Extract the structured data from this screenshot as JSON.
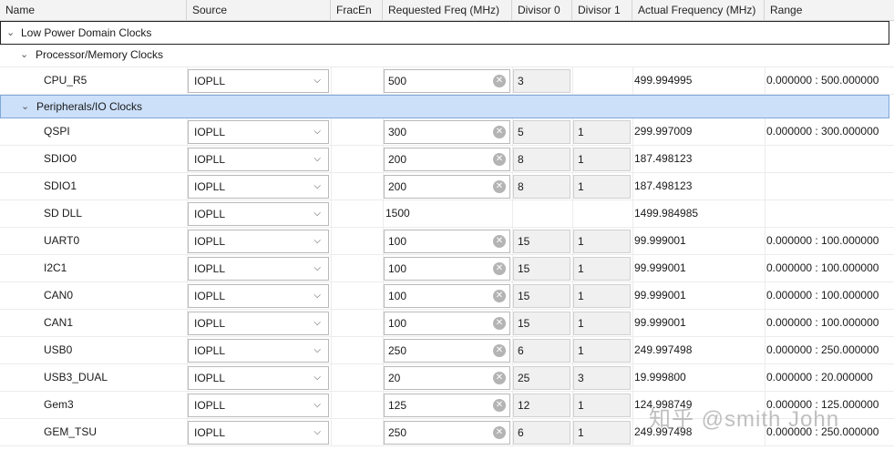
{
  "columns": [
    "Name",
    "Source",
    "FracEn",
    "Requested Freq (MHz)",
    "Divisor 0",
    "Divisor 1",
    "Actual Frequency (MHz)",
    "Range"
  ],
  "groups": {
    "low_power": "Low Power Domain Clocks",
    "proc_mem": "Processor/Memory Clocks",
    "periph_io": "Peripherals/IO Clocks"
  },
  "rows": [
    {
      "name": "CPU_R5",
      "source": "IOPLL",
      "req": "500",
      "div0": "3",
      "div1": "",
      "actual": "499.994995",
      "range": "0.000000 : 500.000000"
    },
    {
      "name": "QSPI",
      "source": "IOPLL",
      "req": "300",
      "div0": "5",
      "div1": "1",
      "actual": "299.997009",
      "range": "0.000000 : 300.000000"
    },
    {
      "name": "SDIO0",
      "source": "IOPLL",
      "req": "200",
      "div0": "8",
      "div1": "1",
      "actual": "187.498123",
      "range": ""
    },
    {
      "name": "SDIO1",
      "source": "IOPLL",
      "req": "200",
      "div0": "8",
      "div1": "1",
      "actual": "187.498123",
      "range": ""
    },
    {
      "name": "SD DLL",
      "source": "IOPLL",
      "req": "1500",
      "div0": "",
      "div1": "",
      "actual": "1499.984985",
      "range": ""
    },
    {
      "name": "UART0",
      "source": "IOPLL",
      "req": "100",
      "div0": "15",
      "div1": "1",
      "actual": "99.999001",
      "range": "0.000000 : 100.000000"
    },
    {
      "name": "I2C1",
      "source": "IOPLL",
      "req": "100",
      "div0": "15",
      "div1": "1",
      "actual": "99.999001",
      "range": "0.000000 : 100.000000"
    },
    {
      "name": "CAN0",
      "source": "IOPLL",
      "req": "100",
      "div0": "15",
      "div1": "1",
      "actual": "99.999001",
      "range": "0.000000 : 100.000000"
    },
    {
      "name": "CAN1",
      "source": "IOPLL",
      "req": "100",
      "div0": "15",
      "div1": "1",
      "actual": "99.999001",
      "range": "0.000000 : 100.000000"
    },
    {
      "name": "USB0",
      "source": "IOPLL",
      "req": "250",
      "div0": "6",
      "div1": "1",
      "actual": "249.997498",
      "range": "0.000000 : 250.000000"
    },
    {
      "name": "USB3_DUAL",
      "source": "IOPLL",
      "req": "20",
      "div0": "25",
      "div1": "3",
      "actual": "19.999800",
      "range": "0.000000 : 20.000000"
    },
    {
      "name": "Gem3",
      "source": "IOPLL",
      "req": "125",
      "div0": "12",
      "div1": "1",
      "actual": "124.998749",
      "range": "0.000000 : 125.000000"
    },
    {
      "name": "GEM_TSU",
      "source": "IOPLL",
      "req": "250",
      "div0": "6",
      "div1": "1",
      "actual": "249.997498",
      "range": "0.000000 : 250.000000"
    }
  ],
  "watermark": "知乎 @smith John",
  "colors": {
    "selected_row": "#cce0fa",
    "header_bg": "#f3f3f3"
  }
}
